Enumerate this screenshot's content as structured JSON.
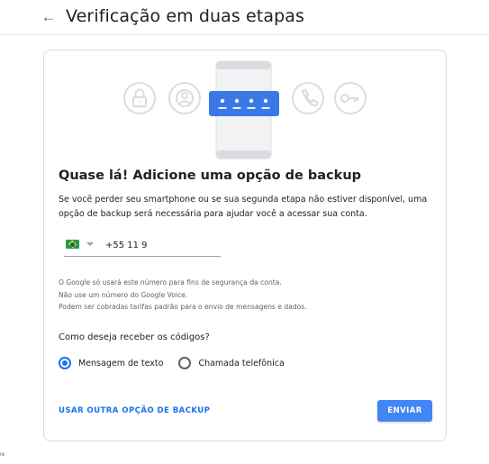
{
  "header": {
    "title": "Verificação em duas etapas"
  },
  "illustration": {
    "code_display": "• • • •"
  },
  "card": {
    "heading": "Quase lá! Adicione uma opção de backup",
    "description": "Se você perder seu smartphone ou se sua segunda etapa não estiver disponível, uma opção de backup será necessária para ajudar você a acessar sua conta.",
    "phone": {
      "country": "Brasil",
      "value": "+55 11 9"
    },
    "notes": [
      "O Google só usará este número para fins de segurança da conta.",
      "Não use um número do Google Voice.",
      "Podem ser cobradas tarifas padrão para o envio de mensagens e dados."
    ],
    "question": "Como deseja receber os códigos?",
    "options": [
      {
        "label": "Mensagem de texto",
        "selected": true
      },
      {
        "label": "Chamada telefônica",
        "selected": false
      }
    ],
    "alt_link": "USAR OUTRA OPÇÃO DE BACKUP",
    "submit_label": "ENVIAR"
  },
  "footer": {
    "corner_text": "re"
  },
  "colors": {
    "accent": "#1a73e8",
    "button": "#4285f4",
    "code_box": "#3b78e7",
    "icon_gray": "#dadce0"
  }
}
